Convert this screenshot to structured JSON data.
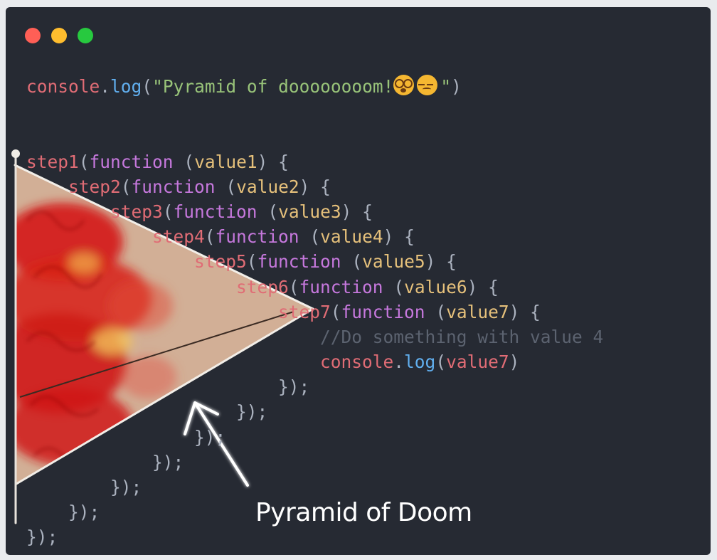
{
  "window": {
    "controls": [
      "close",
      "minimize",
      "zoom"
    ],
    "colors": {
      "close": "#ff5f56",
      "minimize": "#ffbd2e",
      "zoom": "#27c93f",
      "background": "#262a33"
    }
  },
  "code": {
    "line1": {
      "obj": "console",
      "dot": ".",
      "method": "log",
      "open": "(",
      "string": "\"Pyramid of doooooooom!",
      "string_end": "\"",
      "close": ")",
      "emoji": [
        "dizzy-face-emoji",
        "woozy-face-emoji"
      ]
    },
    "steps": [
      {
        "name": "step1",
        "kw": "function",
        "param": "value1"
      },
      {
        "name": "step2",
        "kw": "function",
        "param": "value2"
      },
      {
        "name": "step3",
        "kw": "function",
        "param": "value3"
      },
      {
        "name": "step4",
        "kw": "function",
        "param": "value4"
      },
      {
        "name": "step5",
        "kw": "function",
        "param": "value5"
      },
      {
        "name": "step6",
        "kw": "function",
        "param": "value6"
      },
      {
        "name": "step7",
        "kw": "function",
        "param": "value7"
      }
    ],
    "comment": "//Do something with value 4",
    "inner": {
      "obj": "console",
      "dot": ".",
      "method": "log",
      "arg": "value7"
    },
    "closer": "});",
    "colors": {
      "function_name": "#e06c75",
      "keyword": "#c678dd",
      "param": "#e5c07b",
      "string": "#98c379",
      "method": "#61afef",
      "comment": "#5c6370",
      "punct": "#abb2bf"
    }
  },
  "annotation": {
    "caption": "Pyramid of Doom",
    "drawing": "hand-drawn-pyramid-with-fire-and-arrow"
  }
}
